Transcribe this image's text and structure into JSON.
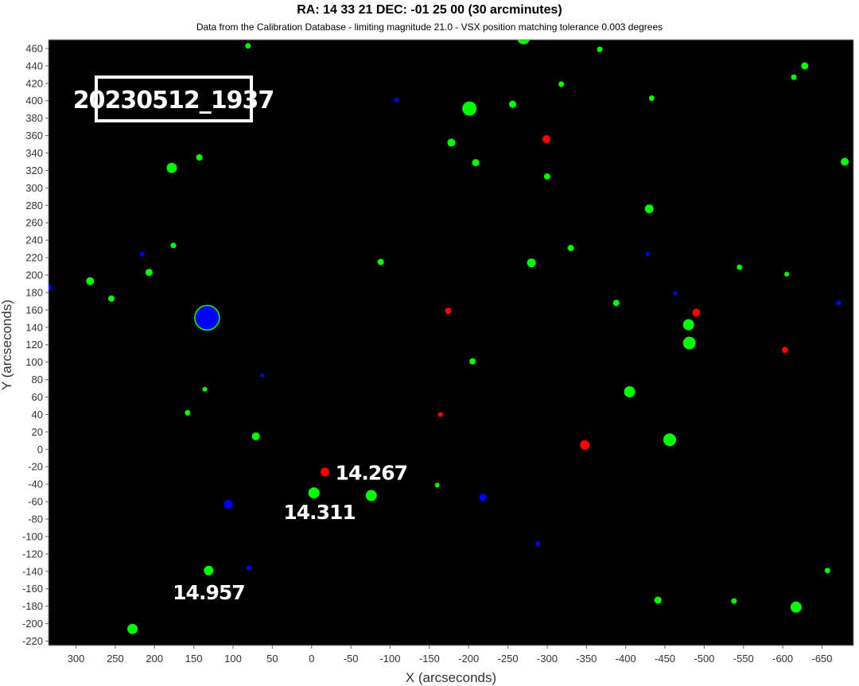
{
  "title": "RA: 14 33 21  DEC: -01 25 00 (30 arcminutes)",
  "subtitle": "Data from the Calibration Database - limiting magnitude 21.0 - VSX position matching tolerance 0.003 degrees",
  "chart_data": {
    "type": "scatter",
    "xlabel": "X (arcseconds)",
    "ylabel": "Y (arcseconds)",
    "xlim": [
      335,
      -690
    ],
    "ylim": [
      -225,
      470
    ],
    "x_ticks": [
      300,
      250,
      200,
      150,
      100,
      50,
      0,
      -50,
      -100,
      -150,
      -200,
      -250,
      -300,
      -350,
      -400,
      -450,
      -500,
      -550,
      -600,
      -650
    ],
    "y_ticks": [
      460,
      440,
      420,
      400,
      380,
      360,
      340,
      320,
      300,
      280,
      260,
      240,
      220,
      200,
      180,
      160,
      140,
      120,
      100,
      80,
      60,
      40,
      20,
      0,
      -20,
      -40,
      -60,
      -80,
      -100,
      -120,
      -140,
      -160,
      -180,
      -200,
      -220
    ],
    "background": "#000000",
    "colors": {
      "green": "#00ff00",
      "blue": "#0000ff",
      "red": "#ff0000"
    },
    "label_box": "20230512_1937",
    "annotations": [
      {
        "text": "14.267",
        "x": -76,
        "y": -35
      },
      {
        "text": "14.311",
        "x": -10,
        "y": -80
      },
      {
        "text": "14.957",
        "x": 131,
        "y": -172
      }
    ],
    "points": [
      {
        "x": 81,
        "y": 463,
        "c": "green",
        "r": 3.5
      },
      {
        "x": -270,
        "y": 472,
        "c": "green",
        "r": 8
      },
      {
        "x": -367,
        "y": 459,
        "c": "green",
        "r": 3.5
      },
      {
        "x": -628,
        "y": 440,
        "c": "green",
        "r": 4.5
      },
      {
        "x": -614,
        "y": 427,
        "c": "green",
        "r": 3.5
      },
      {
        "x": -318,
        "y": 419,
        "c": "green",
        "r": 3.5
      },
      {
        "x": -108,
        "y": 401,
        "c": "blue",
        "r": 3
      },
      {
        "x": -256,
        "y": 396,
        "c": "green",
        "r": 4.5
      },
      {
        "x": -433,
        "y": 403,
        "c": "green",
        "r": 3.5
      },
      {
        "x": -201,
        "y": 391,
        "c": "green",
        "r": 9
      },
      {
        "x": -299,
        "y": 356,
        "c": "red",
        "r": 5
      },
      {
        "x": -178,
        "y": 352,
        "c": "green",
        "r": 5
      },
      {
        "x": 143,
        "y": 335,
        "c": "green",
        "r": 4
      },
      {
        "x": 178,
        "y": 323,
        "c": "green",
        "r": 6.5
      },
      {
        "x": -209,
        "y": 329,
        "c": "green",
        "r": 4.5
      },
      {
        "x": -679,
        "y": 330,
        "c": "green",
        "r": 5
      },
      {
        "x": -300,
        "y": 313,
        "c": "green",
        "r": 4
      },
      {
        "x": -430,
        "y": 276,
        "c": "green",
        "r": 5.5
      },
      {
        "x": 176,
        "y": 234,
        "c": "green",
        "r": 3.5
      },
      {
        "x": -330,
        "y": 231,
        "c": "green",
        "r": 4
      },
      {
        "x": 216,
        "y": 224,
        "c": "blue",
        "r": 3
      },
      {
        "x": -428,
        "y": 224,
        "c": "blue",
        "r": 2.5
      },
      {
        "x": -88,
        "y": 215,
        "c": "green",
        "r": 4
      },
      {
        "x": -280,
        "y": 214,
        "c": "green",
        "r": 5.5
      },
      {
        "x": -545,
        "y": 209,
        "c": "green",
        "r": 3.5
      },
      {
        "x": 207,
        "y": 203,
        "c": "green",
        "r": 4.5
      },
      {
        "x": -605,
        "y": 201,
        "c": "green",
        "r": 3
      },
      {
        "x": 282,
        "y": 193,
        "c": "green",
        "r": 5
      },
      {
        "x": 335,
        "y": 186,
        "c": "blue",
        "r": 4
      },
      {
        "x": -463,
        "y": 179,
        "c": "blue",
        "r": 2.5
      },
      {
        "x": 255,
        "y": 173,
        "c": "green",
        "r": 4
      },
      {
        "x": -388,
        "y": 168,
        "c": "green",
        "r": 4
      },
      {
        "x": -671,
        "y": 168,
        "c": "blue",
        "r": 3
      },
      {
        "x": -174,
        "y": 159,
        "c": "red",
        "r": 4
      },
      {
        "x": -490,
        "y": 157,
        "c": "red",
        "r": 5
      },
      {
        "x": 133,
        "y": 151,
        "c": "blue",
        "r": 15.5,
        "stroke": "#00ff00"
      },
      {
        "x": -480,
        "y": 143,
        "c": "green",
        "r": 7
      },
      {
        "x": -481,
        "y": 122,
        "c": "green",
        "r": 8
      },
      {
        "x": -603,
        "y": 114,
        "c": "red",
        "r": 4
      },
      {
        "x": -205,
        "y": 101,
        "c": "green",
        "r": 4
      },
      {
        "x": 63,
        "y": 85,
        "c": "blue",
        "r": 2.5
      },
      {
        "x": 136,
        "y": 69,
        "c": "green",
        "r": 3
      },
      {
        "x": -405,
        "y": 66,
        "c": "green",
        "r": 7
      },
      {
        "x": 158,
        "y": 42,
        "c": "green",
        "r": 3.5
      },
      {
        "x": -164,
        "y": 40,
        "c": "red",
        "r": 3
      },
      {
        "x": 71,
        "y": 15,
        "c": "green",
        "r": 5
      },
      {
        "x": -456,
        "y": 11,
        "c": "green",
        "r": 8
      },
      {
        "x": -348,
        "y": 5,
        "c": "red",
        "r": 6
      },
      {
        "x": -17,
        "y": -26,
        "c": "red",
        "r": 5.5
      },
      {
        "x": -160,
        "y": -41,
        "c": "green",
        "r": 3
      },
      {
        "x": -3,
        "y": -50,
        "c": "green",
        "r": 7
      },
      {
        "x": -76,
        "y": -53,
        "c": "green",
        "r": 7
      },
      {
        "x": -218,
        "y": -55,
        "c": "blue",
        "r": 4.5
      },
      {
        "x": 106,
        "y": -63,
        "c": "blue",
        "r": 5.5
      },
      {
        "x": -288,
        "y": -108,
        "c": "blue",
        "r": 3
      },
      {
        "x": 80,
        "y": -136,
        "c": "blue",
        "r": 3
      },
      {
        "x": 131,
        "y": -139,
        "c": "green",
        "r": 6
      },
      {
        "x": -657,
        "y": -139,
        "c": "green",
        "r": 3.5
      },
      {
        "x": -441,
        "y": -173,
        "c": "green",
        "r": 4.5
      },
      {
        "x": -538,
        "y": -174,
        "c": "green",
        "r": 3.5
      },
      {
        "x": -617,
        "y": -181,
        "c": "green",
        "r": 7
      },
      {
        "x": 228,
        "y": -206,
        "c": "green",
        "r": 6.5
      }
    ]
  }
}
